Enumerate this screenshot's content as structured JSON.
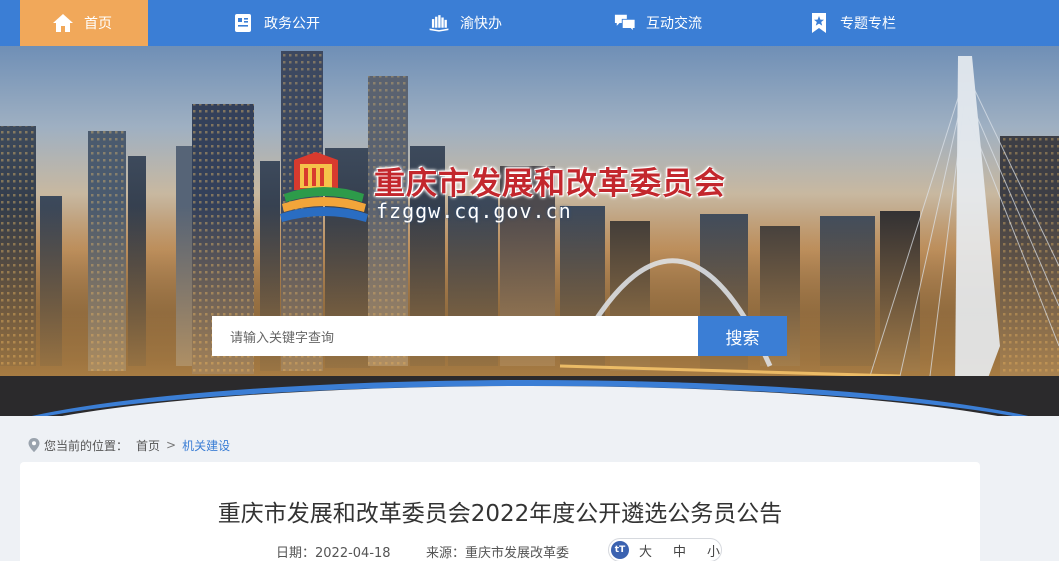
{
  "nav": {
    "items": [
      {
        "label": "首页",
        "icon": "home-icon"
      },
      {
        "label": "政务公开",
        "icon": "id-card-icon"
      },
      {
        "label": "渝快办",
        "icon": "book-icon"
      },
      {
        "label": "互动交流",
        "icon": "chat-icon"
      },
      {
        "label": "专题专栏",
        "icon": "bookmark-star-icon"
      }
    ]
  },
  "banner": {
    "org_name": "重庆市发展和改革委员会",
    "domain": "fzggw.cq.gov.cn"
  },
  "search": {
    "placeholder": "请输入关键字查询",
    "button_label": "搜索"
  },
  "breadcrumb": {
    "prefix": "您当前的位置：",
    "home": "首页",
    "separator": ">",
    "current": "机关建设"
  },
  "article": {
    "title": "重庆市发展和改革委员会2022年度公开遴选公务员公告",
    "date_label": "日期：",
    "date": "2022-04-18",
    "source_label": "来源：",
    "source": "重庆市发展改革委",
    "font_size": {
      "icon_text": "tT",
      "large": "大",
      "medium": "中",
      "small": "小"
    }
  },
  "colors": {
    "nav_bg": "#3b7ed5",
    "nav_active": "#f1a85a",
    "title_red": "#c3272d"
  }
}
